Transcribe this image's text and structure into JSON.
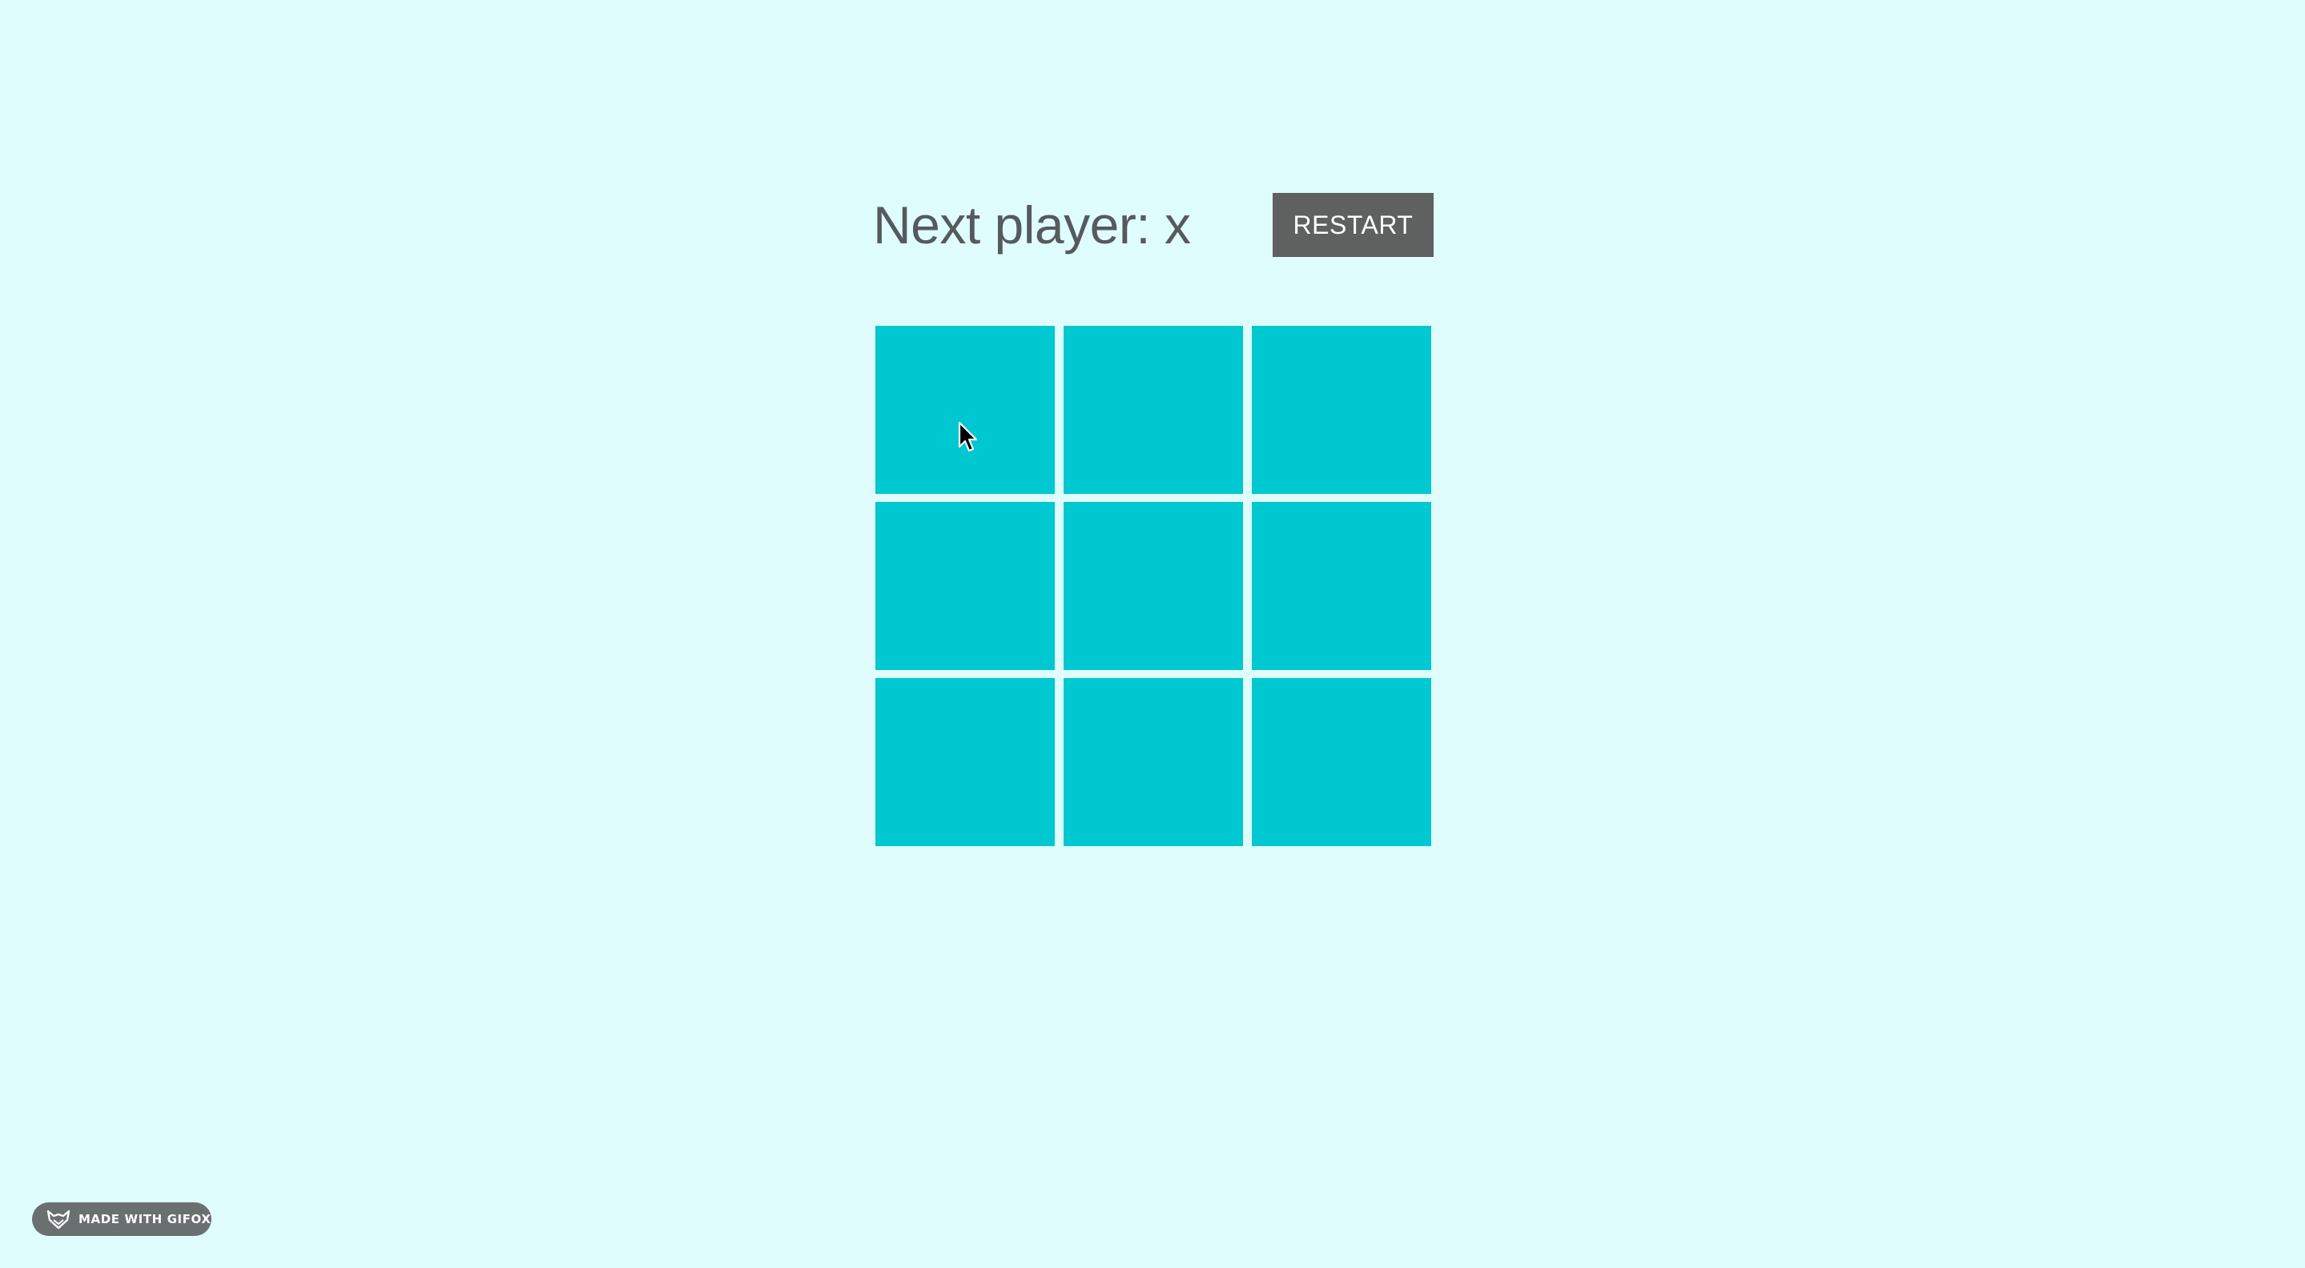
{
  "game": {
    "status_text": "Next player: x",
    "restart_label": "RESTART",
    "board": {
      "cells": [
        "",
        "",
        "",
        "",
        "",
        "",
        "",
        "",
        ""
      ]
    }
  },
  "badge": {
    "text": "MADE WITH GIFOX",
    "icon": "fox-icon"
  },
  "colors": {
    "background": "#e0fdfd",
    "cell": "#00c8d0",
    "button": "#5f6060",
    "status_text": "#555b5d",
    "badge": "#6a6f70"
  }
}
